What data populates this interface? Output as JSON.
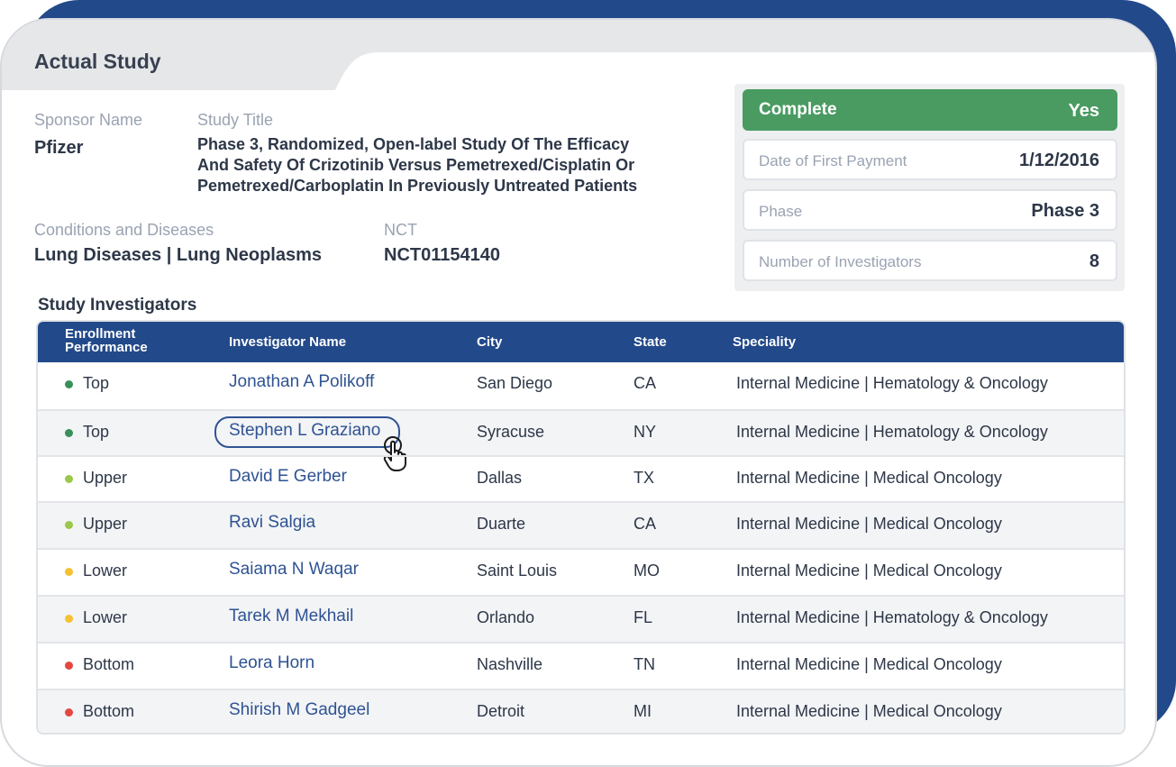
{
  "card": {
    "title": "Actual Study"
  },
  "study": {
    "sponsor_label": "Sponsor Name",
    "sponsor": "Pfizer",
    "title_label": "Study Title",
    "title_lines": [
      "Phase 3, Randomized, Open-label Study Of The Efficacy",
      "And Safety Of Crizotinib Versus Pemetrexed/Cisplatin Or",
      "Pemetrexed/Carboplatin In Previously Untreated Patients"
    ],
    "conditions_label": "Conditions and Diseases",
    "conditions": "Lung Diseases | Lung Neoplasms",
    "nct_label": "NCT",
    "nct": "NCT01154140"
  },
  "summary": {
    "complete_label": "Complete",
    "complete_value": "Yes",
    "first_payment_label": "Date of First Payment",
    "first_payment_value": "1/12/2016",
    "phase_label": "Phase",
    "phase_value": "Phase 3",
    "investigators_label": "Number of Investigators",
    "investigators_value": "8"
  },
  "investigators": {
    "title": "Study Investigators",
    "headers": {
      "enrollment": "Enrollment Performance",
      "name": "Investigator Name",
      "city": "City",
      "state": "State",
      "speciality": "Speciality"
    },
    "rows": [
      {
        "performance": "Top",
        "name": "Jonathan A Polikoff",
        "city": "San Diego",
        "state": "CA",
        "speciality": "Internal Medicine | Hematology & Oncology"
      },
      {
        "performance": "Top",
        "name": "Stephen L Graziano",
        "city": "Syracuse",
        "state": "NY",
        "speciality": "Internal Medicine | Hematology & Oncology"
      },
      {
        "performance": "Upper",
        "name": "David E Gerber",
        "city": "Dallas",
        "state": "TX",
        "speciality": "Internal Medicine | Medical Oncology"
      },
      {
        "performance": "Upper",
        "name": "Ravi Salgia",
        "city": "Duarte",
        "state": "CA",
        "speciality": "Internal Medicine | Medical Oncology"
      },
      {
        "performance": "Lower",
        "name": "Saiama N Waqar",
        "city": "Saint Louis",
        "state": "MO",
        "speciality": "Internal Medicine | Medical Oncology"
      },
      {
        "performance": "Lower",
        "name": "Tarek M Mekhail",
        "city": "Orlando",
        "state": "FL",
        "speciality": "Internal Medicine | Hematology & Oncology"
      },
      {
        "performance": "Bottom",
        "name": "Leora Horn",
        "city": "Nashville",
        "state": "TN",
        "speciality": "Internal Medicine | Medical Oncology"
      },
      {
        "performance": "Bottom",
        "name": "Shirish M Gadgeel",
        "city": "Detroit",
        "state": "MI",
        "speciality": "Internal Medicine | Medical Oncology"
      }
    ]
  },
  "colors": {
    "header_blue": "#22498a",
    "complete_green": "#4a9b62",
    "performance": {
      "Top": "#3a8f5a",
      "Upper": "#9cc84a",
      "Lower": "#f5c12e",
      "Bottom": "#e4473f"
    }
  },
  "icons": {
    "cursor": "hand-pointer-icon",
    "status": "status-dot-icon"
  }
}
